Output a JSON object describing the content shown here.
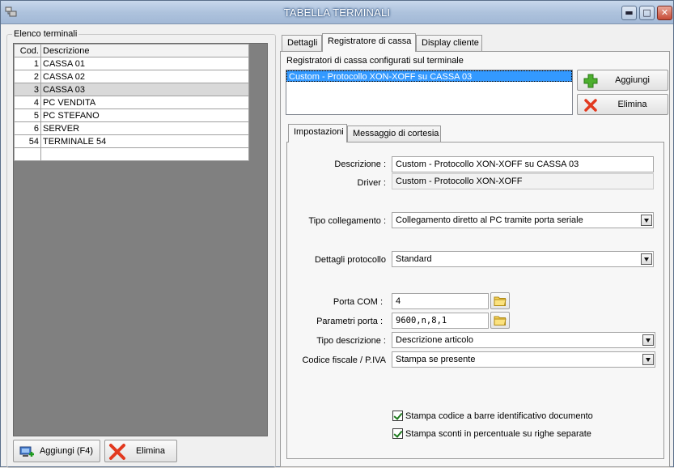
{
  "window": {
    "title": "TABELLA TERMINALI"
  },
  "controls": {
    "minimize": "▬",
    "maximize": "□",
    "close": "✕"
  },
  "left": {
    "group_label": "Elenco terminali",
    "columns": {
      "code": "Cod.",
      "description": "Descrizione"
    },
    "rows": [
      {
        "code": "1",
        "description": "CASSA 01"
      },
      {
        "code": "2",
        "description": "CASSA 02"
      },
      {
        "code": "3",
        "description": "CASSA 03"
      },
      {
        "code": "4",
        "description": "PC VENDITA"
      },
      {
        "code": "5",
        "description": "PC STEFANO"
      },
      {
        "code": "6",
        "description": "SERVER"
      },
      {
        "code": "54",
        "description": "TERMINALE 54"
      }
    ],
    "selected_row": 2,
    "add_button": "Aggiungi (F4)",
    "delete_button": "Elimina"
  },
  "tabs": [
    {
      "label": "Dettagli"
    },
    {
      "label": "Registratore di cassa"
    },
    {
      "label": "Display cliente"
    }
  ],
  "register": {
    "list_label": "Registratori di cassa configurati sul terminale",
    "list_items": [
      "Custom - Protocollo XON-XOFF su CASSA 03"
    ],
    "add_button": "Aggiungi",
    "delete_button": "Elimina"
  },
  "subtabs": [
    {
      "label": "Impostazioni"
    },
    {
      "label": "Messaggio di cortesia"
    }
  ],
  "settings": {
    "descrizione_label": "Descrizione :",
    "descrizione_value": "Custom - Protocollo XON-XOFF su CASSA 03",
    "driver_label": "Driver :",
    "driver_value": "Custom - Protocollo XON-XOFF",
    "tipo_collegamento_label": "Tipo collegamento :",
    "tipo_collegamento_value": "Collegamento diretto al PC tramite porta seriale",
    "dettagli_protocollo_label": "Dettagli protocollo",
    "dettagli_protocollo_value": "Standard",
    "porta_com_label": "Porta COM :",
    "porta_com_value": "4",
    "parametri_porta_label": "Parametri porta :",
    "parametri_porta_value": "9600,n,8,1",
    "tipo_descrizione_label": "Tipo descrizione :",
    "tipo_descrizione_value": "Descrizione articolo",
    "codice_fiscale_label": "Codice fiscale / P.IVA",
    "codice_fiscale_value": "Stampa se presente",
    "check_barcode": "Stampa codice a barre identificativo documento",
    "check_barcode_checked": true,
    "check_sconti": "Stampa sconti in percentuale su righe separate",
    "check_sconti_checked": true
  }
}
